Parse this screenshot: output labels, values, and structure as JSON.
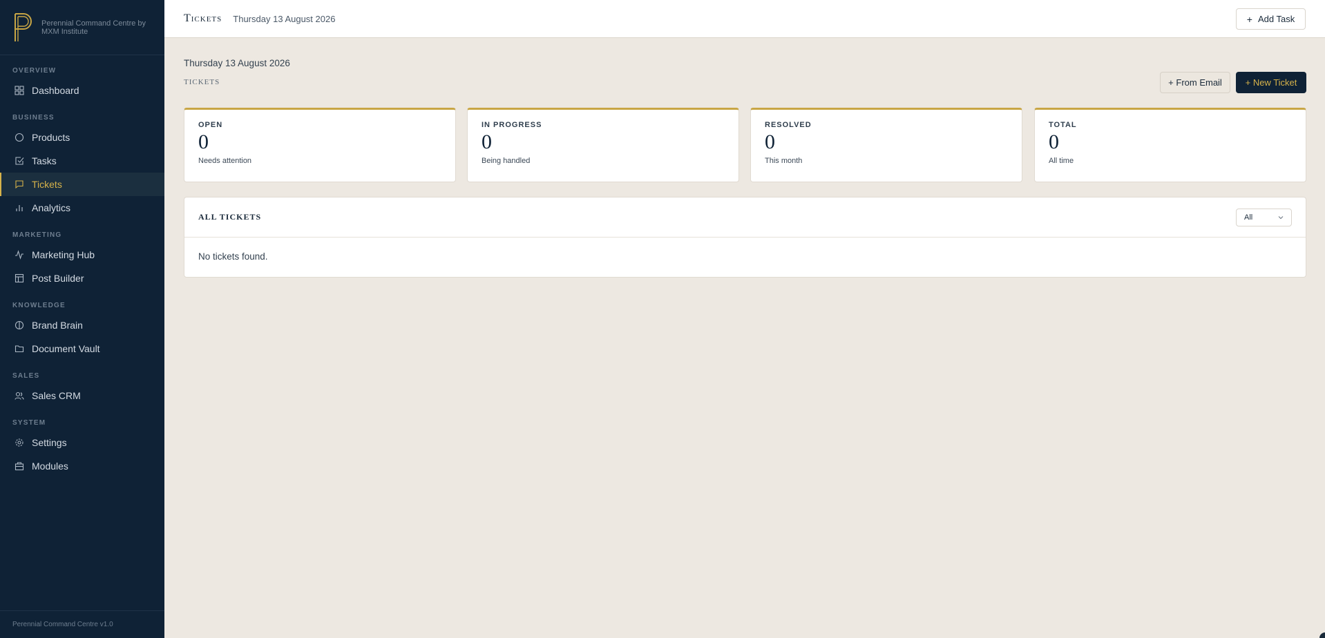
{
  "app": {
    "brand_text": "Perennial Command Centre by MXM Institute",
    "footer": "Perennial Command Centre v1.0"
  },
  "sidebar": {
    "sections": [
      {
        "heading": "OVERVIEW",
        "items": [
          {
            "label": "Dashboard",
            "icon": "grid-icon"
          }
        ]
      },
      {
        "heading": "BUSINESS",
        "items": [
          {
            "label": "Products",
            "icon": "circle-icon"
          },
          {
            "label": "Tasks",
            "icon": "checkbox-icon"
          },
          {
            "label": "Tickets",
            "icon": "chat-icon",
            "active": true
          },
          {
            "label": "Analytics",
            "icon": "bar-chart-icon"
          }
        ]
      },
      {
        "heading": "MARKETING",
        "items": [
          {
            "label": "Marketing Hub",
            "icon": "activity-icon"
          },
          {
            "label": "Post Builder",
            "icon": "layout-icon"
          }
        ]
      },
      {
        "heading": "KNOWLEDGE",
        "items": [
          {
            "label": "Brand Brain",
            "icon": "brain-icon"
          },
          {
            "label": "Document Vault",
            "icon": "folder-icon"
          }
        ]
      },
      {
        "heading": "SALES",
        "items": [
          {
            "label": "Sales CRM",
            "icon": "users-icon"
          }
        ]
      },
      {
        "heading": "SYSTEM",
        "items": [
          {
            "label": "Settings",
            "icon": "gear-icon"
          },
          {
            "label": "Modules",
            "icon": "package-icon"
          }
        ]
      }
    ]
  },
  "topbar": {
    "title": "Tickets",
    "date": "Thursday 13 August 2026",
    "add_task": "Add Task"
  },
  "page": {
    "date": "Thursday 13 August 2026",
    "label": "TICKETS",
    "from_email": "+ From Email",
    "new_ticket": "+ New Ticket"
  },
  "stats": [
    {
      "label": "OPEN",
      "value": "0",
      "sub": "Needs attention"
    },
    {
      "label": "IN PROGRESS",
      "value": "0",
      "sub": "Being handled"
    },
    {
      "label": "RESOLVED",
      "value": "0",
      "sub": "This month"
    },
    {
      "label": "TOTAL",
      "value": "0",
      "sub": "All time"
    }
  ],
  "tickets": {
    "title": "ALL TICKETS",
    "filter_value": "All",
    "empty": "No tickets found."
  },
  "colors": {
    "sidebar_bg": "#0f2236",
    "accent_gold": "#c8a645",
    "page_bg": "#ede8e1"
  }
}
